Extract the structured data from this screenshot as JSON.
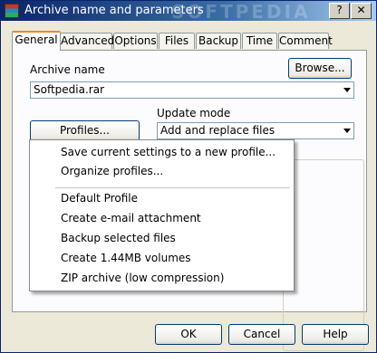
{
  "window": {
    "title": "Archive name and parameters",
    "minimize_glyph": "?",
    "close_glyph": "✕"
  },
  "tabs": [
    "General",
    "Advanced",
    "Options",
    "Files",
    "Backup",
    "Time",
    "Comment"
  ],
  "general": {
    "archive_name_label": "Archive name",
    "browse_label": "Browse...",
    "archive_name_value": "Softpedia.rar",
    "update_mode_label": "Update mode",
    "update_mode_value": "Add and replace files",
    "profiles_label": "Profiles..."
  },
  "profiles_menu": {
    "items": [
      "Save current settings to a new profile...",
      "Organize profiles...",
      "Default Profile",
      "Create e-mail attachment",
      "Backup selected files",
      "Create 1.44MB volumes",
      "ZIP archive (low compression)"
    ]
  },
  "footer": {
    "ok_label": "OK",
    "cancel_label": "Cancel",
    "help_label": "Help"
  },
  "watermark": "SOFTPEDIA"
}
